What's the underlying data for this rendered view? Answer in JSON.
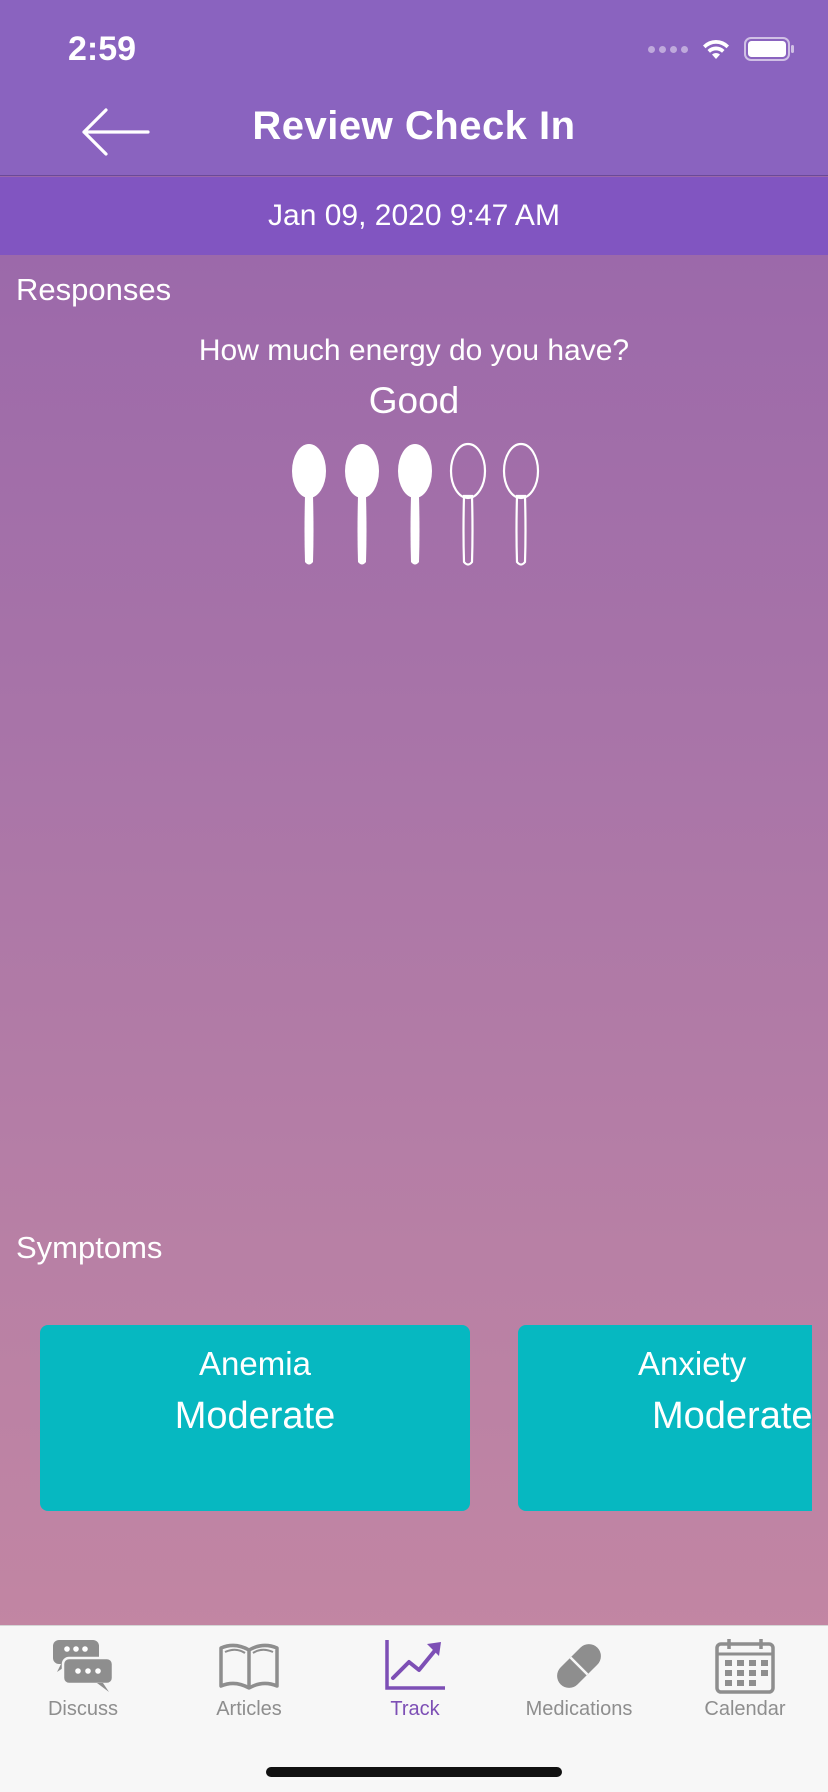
{
  "status_bar": {
    "time": "2:59"
  },
  "header": {
    "title": "Review Check In",
    "back_icon": "arrow-left-icon"
  },
  "date_bar": {
    "datetime": "Jan 09, 2020 9:47 AM"
  },
  "responses": {
    "section_label": "Responses",
    "question": "How much energy do you have?",
    "answer": "Good",
    "rating": {
      "filled": 3,
      "total": 5,
      "icon": "spoon-icon"
    }
  },
  "symptoms": {
    "section_label": "Symptoms",
    "items": [
      {
        "name": "Anemia",
        "severity": "Moderate"
      },
      {
        "name": "Anxiety",
        "severity": "Moderate"
      }
    ]
  },
  "colors": {
    "header_bg": "#8a63bf",
    "date_bar_bg": "#8155c1",
    "card_bg": "#06b8c1",
    "tab_active": "#7d4fb5",
    "tab_inactive": "#8e8e8e"
  },
  "tabbar": {
    "tabs": [
      {
        "label": "Discuss",
        "icon": "chat-bubbles-icon",
        "active": false
      },
      {
        "label": "Articles",
        "icon": "open-book-icon",
        "active": false
      },
      {
        "label": "Track",
        "icon": "trend-chart-icon",
        "active": true
      },
      {
        "label": "Medications",
        "icon": "pill-icon",
        "active": false
      },
      {
        "label": "Calendar",
        "icon": "calendar-icon",
        "active": false
      }
    ]
  }
}
